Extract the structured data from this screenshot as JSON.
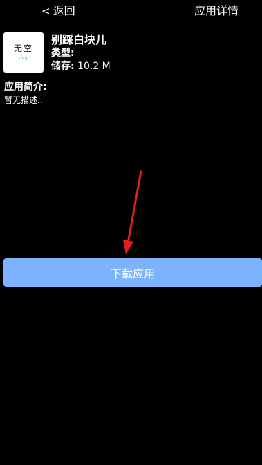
{
  "header": {
    "back_chevron": "<",
    "back_label": "返回",
    "title": "应用详情"
  },
  "app": {
    "icon_text": "无空",
    "icon_subtext": "shop",
    "name": "别踩白块儿",
    "type_label": "类型:",
    "type_value": "",
    "storage_label": "储存:",
    "storage_value": "10.2 M"
  },
  "description": {
    "title": "应用简介:",
    "text": "暂无描述.."
  },
  "actions": {
    "download_label": "下载应用"
  },
  "colors": {
    "background": "#000000",
    "button": "#7db2ff",
    "arrow": "#e02020"
  }
}
